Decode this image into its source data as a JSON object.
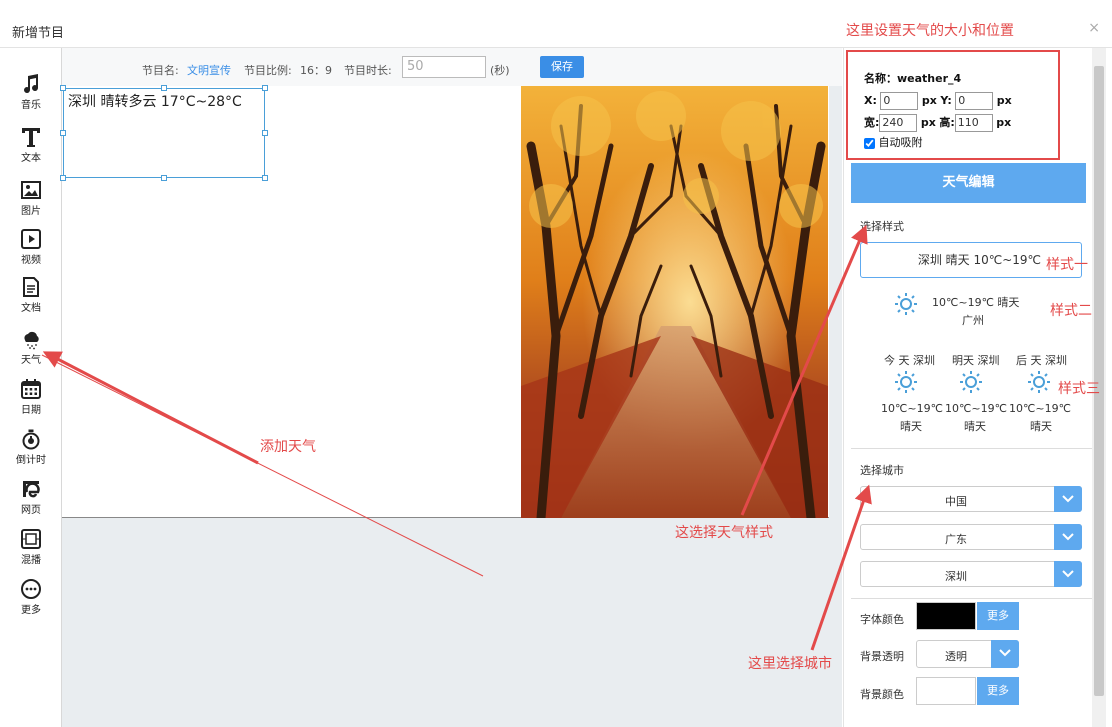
{
  "dialog": {
    "title": "新增节目",
    "close": "×"
  },
  "toolbar": [
    {
      "label": "音乐",
      "icon": "music-note-icon"
    },
    {
      "label": "文本",
      "icon": "text-icon"
    },
    {
      "label": "图片",
      "icon": "image-icon"
    },
    {
      "label": "视频",
      "icon": "video-icon"
    },
    {
      "label": "文档",
      "icon": "document-icon"
    },
    {
      "label": "天气",
      "icon": "weather-icon"
    },
    {
      "label": "日期",
      "icon": "calendar-icon"
    },
    {
      "label": "倒计时",
      "icon": "stopwatch-icon"
    },
    {
      "label": "网页",
      "icon": "web-icon"
    },
    {
      "label": "混播",
      "icon": "film-icon"
    },
    {
      "label": "更多",
      "icon": "more-icon"
    }
  ],
  "program": {
    "name_label": "节目名:",
    "name_value": "文明宣传",
    "ratio_label": "节目比例:",
    "ratio_value": "16：9",
    "duration_label": "节目时长:",
    "duration_value": "50",
    "duration_unit": "(秒)",
    "save_label": "保存"
  },
  "canvas": {
    "weather_text": "深圳   晴转多云    17°C~28°C"
  },
  "props": {
    "name_label": "名称：",
    "name_value": "weather_4",
    "x_label": "X:",
    "x_value": "0",
    "y_label": "Y:",
    "y_value": "0",
    "width_label": "宽:",
    "width_value": "240",
    "height_label": "高:",
    "height_value": "110",
    "unit": "px",
    "snap_label": "自动吸附",
    "snap_checked": true
  },
  "editor": {
    "header": "天气编辑",
    "style_section": "选择样式",
    "style_one_text": "深圳 晴天 10℃~19℃",
    "style_two_temp": "10℃~19℃ 晴天",
    "style_two_city": "广州",
    "style_three_days": [
      {
        "day": "今 天 深圳",
        "temp": "10℃~19℃",
        "cond": "晴天"
      },
      {
        "day": "明天 深圳",
        "temp": "10℃~19℃",
        "cond": "晴天"
      },
      {
        "day": "后 天 深圳",
        "temp": "10℃~19℃",
        "cond": "晴天"
      }
    ],
    "city_section": "选择城市",
    "country": "中国",
    "province": "广东",
    "city": "深圳",
    "font_color_label": "字体颜色",
    "font_color": "#000000",
    "more_label": "更多",
    "bg_alpha_label": "背景透明",
    "bg_alpha_value": "透明",
    "bg_color_label": "背景颜色",
    "bg_color": "#ffffff"
  },
  "annotations": {
    "top": "这里设置天气的大小和位置",
    "add_weather": "添加天气",
    "choose_style": "这选择天气样式",
    "choose_city": "这里选择城市",
    "style1": "样式一",
    "style2": "样式二",
    "style3": "样式三"
  },
  "colors": {
    "accent": "#5ea9ef",
    "annotation": "#e34a4a",
    "link": "#3a8ee6"
  }
}
